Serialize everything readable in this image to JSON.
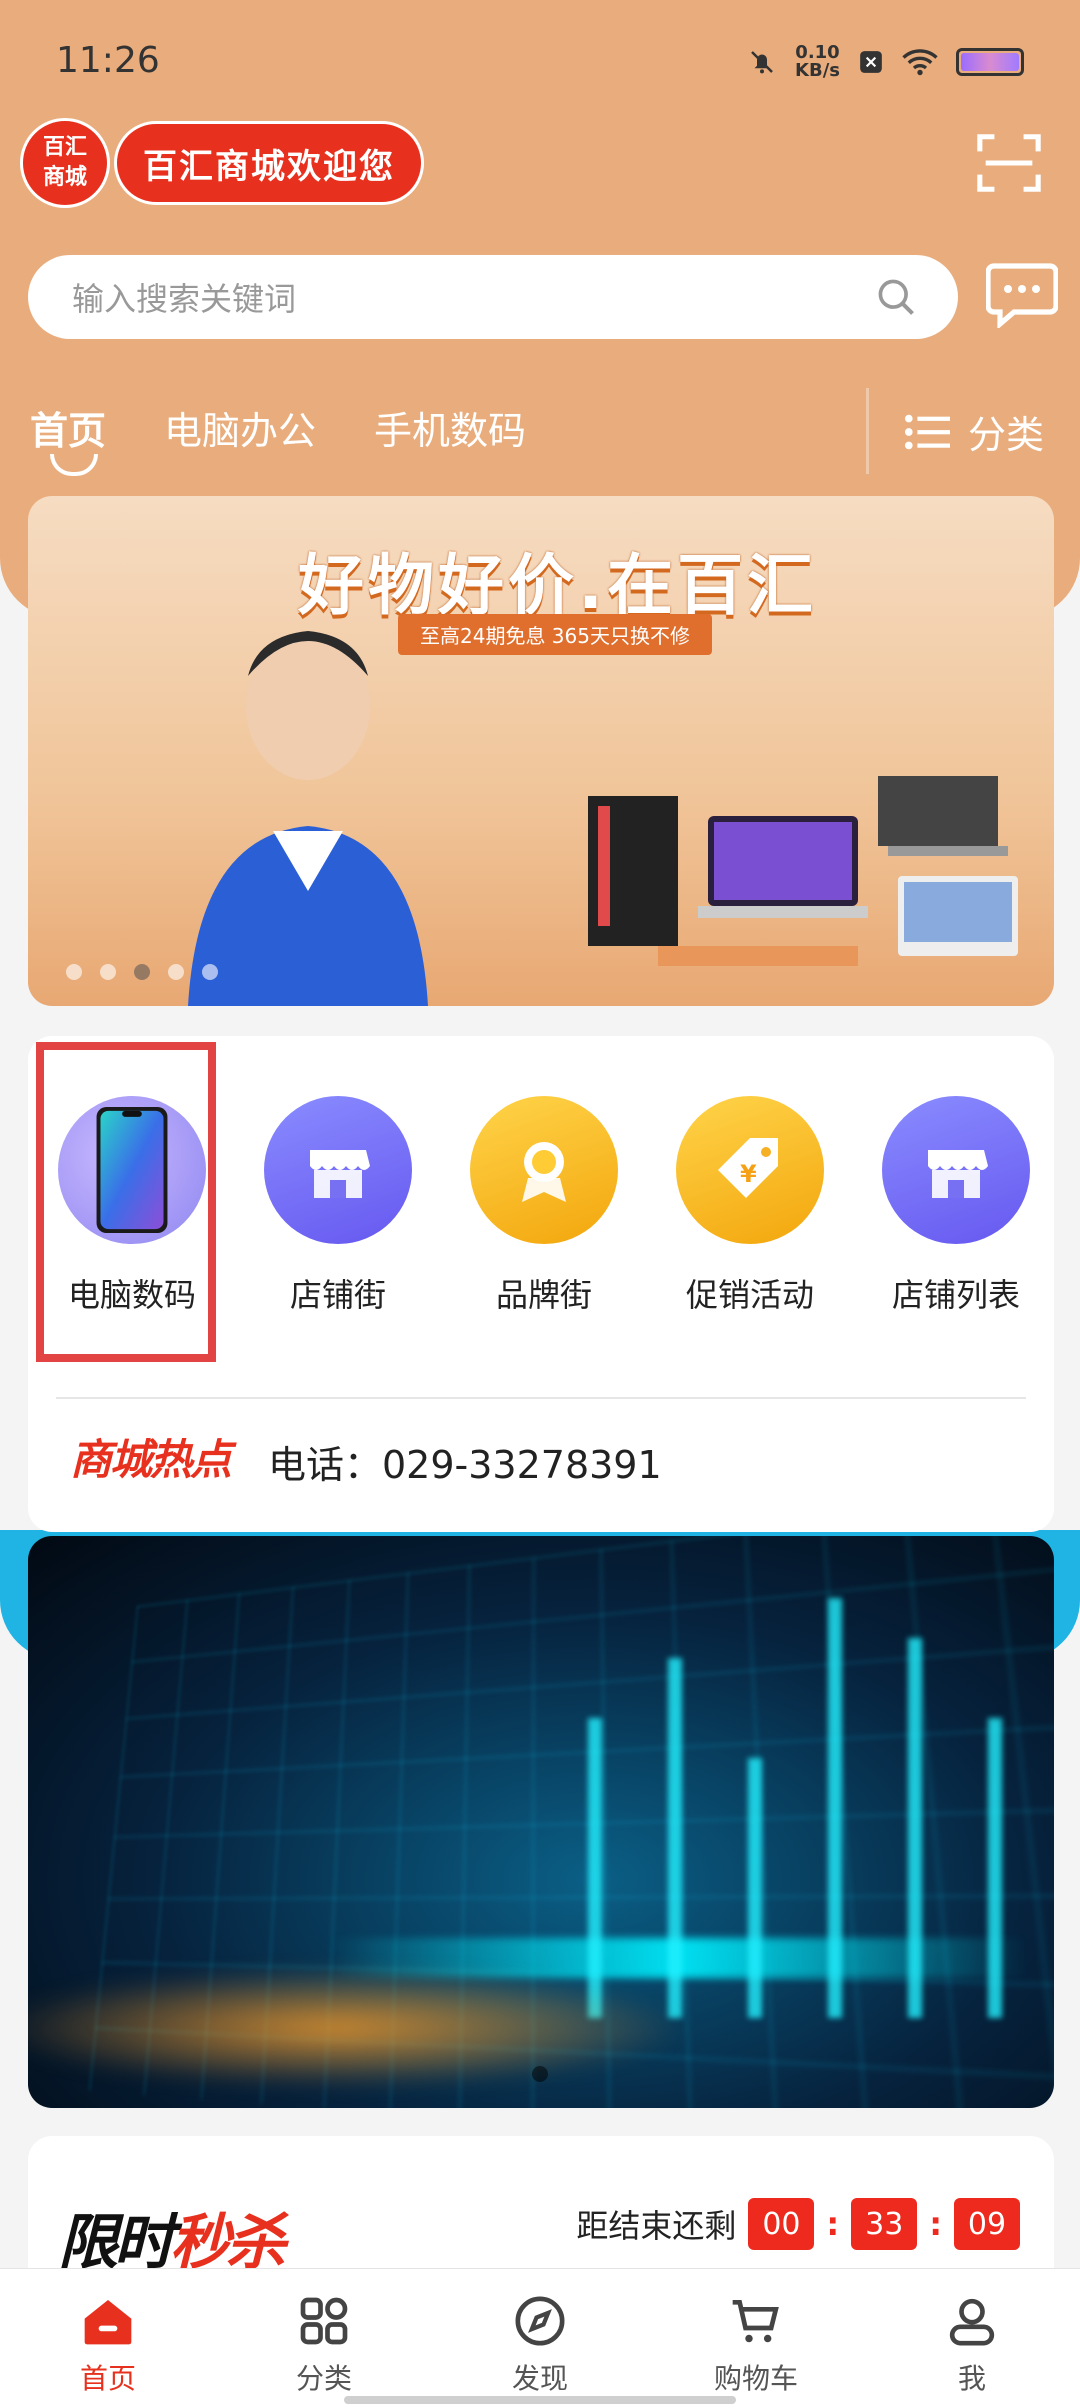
{
  "status_bar": {
    "time": "11:26",
    "speed_value": "0.10",
    "speed_unit": "KB/s"
  },
  "header": {
    "logo_circle_line1": "百汇",
    "logo_circle_line2": "商城",
    "logo_text": "百汇商城欢迎您",
    "scan_icon": "scan-icon",
    "message_icon": "message-icon"
  },
  "search": {
    "placeholder": "输入搜索关键词",
    "icon": "search-icon"
  },
  "tabs": [
    {
      "label": "首页",
      "active": true
    },
    {
      "label": "电脑办公",
      "active": false
    },
    {
      "label": "手机数码",
      "active": false
    }
  ],
  "category_button": {
    "label": "分类",
    "icon": "list-icon"
  },
  "banner": {
    "title": "好物好价.在百汇",
    "subtitle": "至高24期免息 365天只换不修",
    "dots": 5,
    "active_dot": 2
  },
  "quick_nav": [
    {
      "label": "电脑数码",
      "icon": "phone-icon",
      "highlighted": true
    },
    {
      "label": "店铺街",
      "icon": "shop-icon"
    },
    {
      "label": "品牌街",
      "icon": "brand-badge-icon"
    },
    {
      "label": "促销活动",
      "icon": "price-tag-icon"
    },
    {
      "label": "店铺列表",
      "icon": "shop-icon"
    }
  ],
  "hot": {
    "logo": "商城热点",
    "phone": "电话：029-33278391"
  },
  "flash_sale": {
    "logo_part1": "限时",
    "logo_part2": "秒杀",
    "countdown_label": "距结束还剩",
    "hours": "00",
    "minutes": "33",
    "seconds": "09"
  },
  "bottom_nav": [
    {
      "label": "首页",
      "icon": "home-icon",
      "active": true
    },
    {
      "label": "分类",
      "icon": "grid-icon",
      "active": false
    },
    {
      "label": "发现",
      "icon": "compass-icon",
      "active": false
    },
    {
      "label": "购物车",
      "icon": "cart-icon",
      "active": false
    },
    {
      "label": "我",
      "icon": "user-icon",
      "active": false
    }
  ],
  "colors": {
    "header": "#e9ad7d",
    "brand_red": "#e8301e",
    "highlight": "#e24444",
    "accent_blue": "#1fb4e4"
  }
}
